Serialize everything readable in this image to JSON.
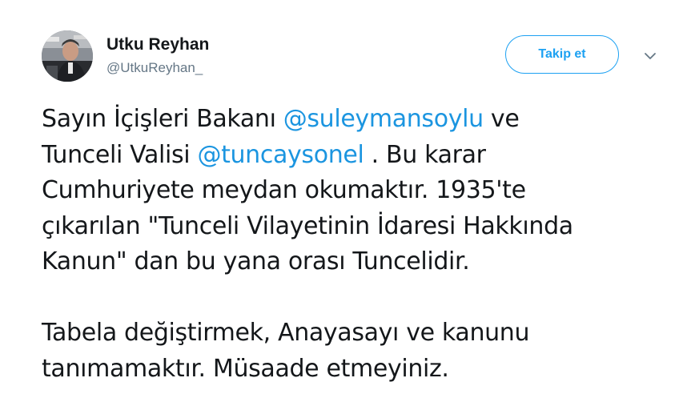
{
  "author": {
    "display_name": "Utku Reyhan",
    "handle": "@UtkuReyhan_"
  },
  "actions": {
    "follow_label": "Takip et"
  },
  "tweet": {
    "line1_before": "Sayın İçişleri Bakanı ",
    "mention1": "@suleymansoylu",
    "line1_after": "  ve",
    "line2_before": "Tunceli Valisi ",
    "mention2": "@tuncaysonel",
    "line2_after": " . Bu karar",
    "line3": "Cumhuriyete meydan okumaktır. 1935'te",
    "line4": "çıkarılan \"Tunceli Vilayetinin İdaresi Hakkında",
    "line5": "Kanun\" dan bu yana orası Tuncelidir.",
    "line6": "Tabela değiştirmek, Anayasayı ve kanunu",
    "line7": "tanımamaktır. Müsaade etmeyiniz."
  },
  "colors": {
    "accent": "#1da1f2",
    "mention": "#1b95e0",
    "text": "#14171a",
    "secondary": "#657786"
  },
  "icons": {
    "more": "chevron-down-icon"
  }
}
